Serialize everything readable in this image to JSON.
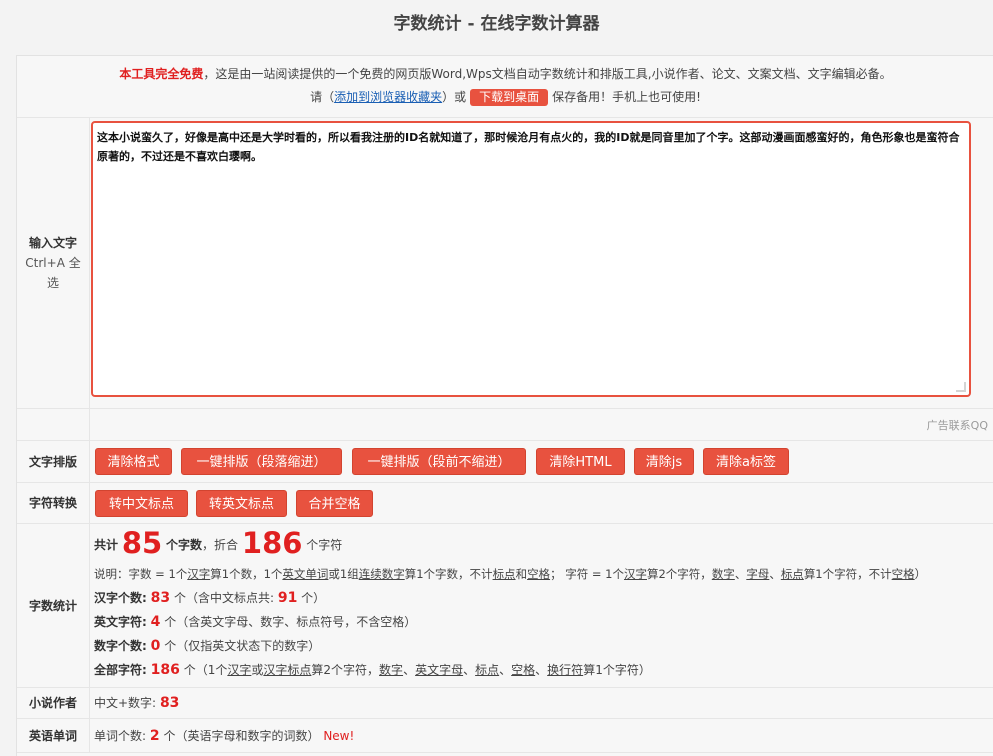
{
  "title": "字数统计 - 在线字数计算器",
  "intro": {
    "free": "本工具完全免费",
    "desc": "，这是由一站阅读提供的一个免费的网页版Word,Wps文档自动字数统计和排版工具,小说作者、论文、文案文档、文字编辑必备。",
    "please": "请（",
    "fav_link": "添加到浏览器收藏夹",
    "or": "）或",
    "download_btn": "下载到桌面",
    "save_tip": "保存备用！手机上也可使用!"
  },
  "input": {
    "label_line1": "输入文字",
    "label_line2": "Ctrl+A 全选",
    "text": "这本小说蛮久了，好像是高中还是大学时看的，所以看我注册的ID名就知道了，那时候沧月有点火的，我的ID就是同音里加了个字。这部动漫画面感蛮好的，角色形象也是蛮符合原著的，不过还是不喜欢白璎啊。",
    "ad": "广告联系QQ"
  },
  "layout_row": {
    "label": "文字排版",
    "buttons": [
      "清除格式",
      "一键排版（段落缩进）",
      "一键排版（段前不缩进）",
      "清除HTML",
      "清除js",
      "清除a标签"
    ]
  },
  "convert_row": {
    "label": "字符转换",
    "buttons": [
      "转中文标点",
      "转英文标点",
      "合并空格"
    ]
  },
  "stats": {
    "label": "字数统计",
    "total_prefix": "共计",
    "word_count": "85",
    "word_unit": "个字数",
    "fold": "，折合",
    "char_count": "186",
    "char_unit": "个字符",
    "explain": {
      "a": "说明：字数 = 1个",
      "hanzi": "汉字",
      "b": "算1个数，1个",
      "enword": "英文单词",
      "c": "或1组",
      "digits": "连续数字",
      "d": "算1个字数，不计",
      "punct": "标点",
      "e": "和",
      "space": "空格",
      "f": "；  字符 = 1个",
      "hanzi2": "汉字",
      "g": "算2个字符，",
      "num": "数字",
      "h": "、",
      "letter": "字母",
      "i": "、",
      "punct2": "标点",
      "j": "算1个字符，不计",
      "space2": "空格",
      "k": "）"
    },
    "hanzi_label": "汉字个数:",
    "hanzi_count": "83",
    "hanzi_unit": "个",
    "hanzi_note_a": "（含中文标点共:",
    "hanzi_punct": "91",
    "hanzi_note_b": "个）",
    "en_label": "英文字符:",
    "en_count": "4",
    "en_unit": "个",
    "en_note": "（含英文字母、数字、标点符号，不含空格）",
    "num_label": "数字个数:",
    "num_count": "0",
    "num_unit": "个",
    "num_note": "（仅指英文状态下的数字）",
    "all_label": "全部字符:",
    "all_count": "186",
    "all_unit": "个",
    "all_note": {
      "a": "（1个",
      "hanzi": "汉字",
      "b": "或",
      "hzpunct": "汉字标点",
      "c": "算2个字符，",
      "num": "数字",
      "d": "、",
      "enletter": "英文字母",
      "e": "、",
      "punct": "标点",
      "f": "、",
      "space": "空格",
      "g": "、",
      "newline": "换行符",
      "h": "算1个字符）"
    }
  },
  "novel": {
    "label": "小说作者",
    "text": "中文+数字:",
    "count": "83"
  },
  "english": {
    "label": "英语单词",
    "text": "单词个数:",
    "count": "2",
    "unit": "个",
    "note": "（英语字母和数字的词数）",
    "new": "New!"
  }
}
